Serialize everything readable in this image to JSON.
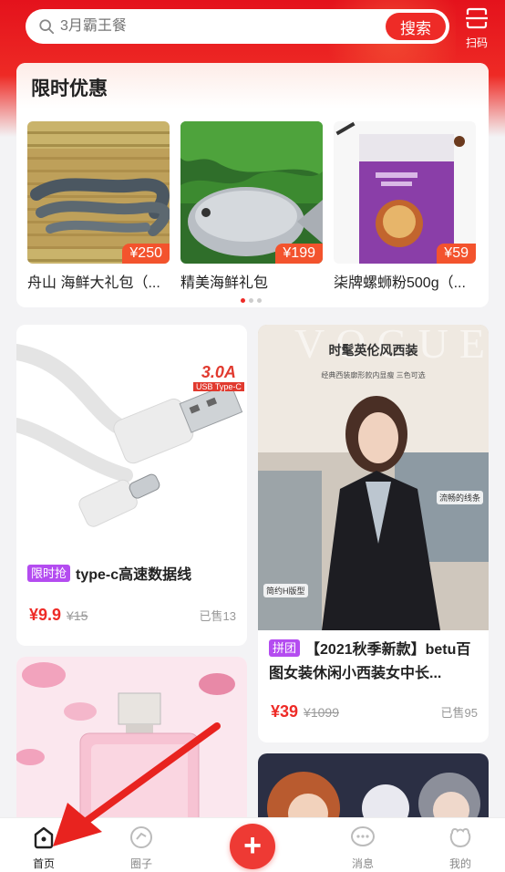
{
  "search": {
    "placeholder": "3月霸王餐",
    "button_label": "搜索"
  },
  "scan": {
    "label": "扫码"
  },
  "promo": {
    "title": "限时优惠",
    "items": [
      {
        "name": "舟山 海鲜大礼包（...",
        "price": "¥250"
      },
      {
        "name": "精美海鲜礼包",
        "price": "¥199"
      },
      {
        "name": "柒牌螺蛳粉500g（...",
        "price": "¥59"
      }
    ]
  },
  "products": [
    {
      "badge": "限时抢",
      "badge_color": "#b44cf0",
      "title": "type-c高速数据线",
      "price": "¥9.9",
      "old_price": "¥15",
      "sold": "已售13",
      "image_text": {
        "line1": "3.0A",
        "line2": "USB Type-C"
      }
    },
    {
      "badge": "拼团",
      "badge_color": "#b44cf0",
      "title": "【2021秋季新款】betu百图女装休闲小西装女中长...",
      "price": "¥39",
      "old_price": "¥1099",
      "sold": "已售95",
      "image_text": {
        "title": "时髦英伦风西装",
        "subtitle": "经典西装廓形款内显瘦 三色可选",
        "tag1": "流畅的线条",
        "tag2": "简约H版型",
        "brand": "VOGUE"
      }
    },
    {
      "title": "",
      "price": "",
      "old_price": "",
      "sold": ""
    },
    {
      "title": "",
      "price": "",
      "old_price": "",
      "sold": ""
    }
  ],
  "nav": {
    "items": [
      {
        "label": "首页",
        "icon": "home-icon",
        "active": true
      },
      {
        "label": "圈子",
        "icon": "circle-icon",
        "active": false
      },
      {
        "label": "+",
        "icon": "plus-icon",
        "active": false
      },
      {
        "label": "消息",
        "icon": "message-icon",
        "active": false
      },
      {
        "label": "我的",
        "icon": "profile-icon",
        "active": false
      }
    ]
  },
  "colors": {
    "brand_red": "#ee2b27",
    "price_tag": "#f3532d",
    "badge_purple": "#b44cf0",
    "annotation_arrow": "#e8231f"
  }
}
